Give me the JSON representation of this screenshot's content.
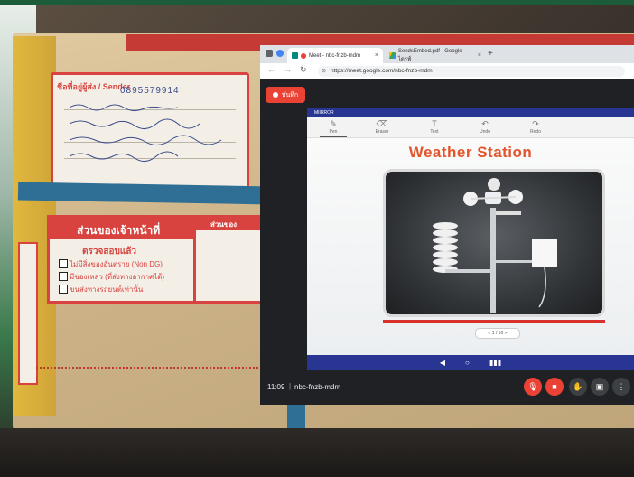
{
  "browser": {
    "tabs": [
      {
        "title": "Meet - nbc-fnzb-mdm",
        "active": true
      },
      {
        "title": "SendsEmbed.pdf - Google ไดรฟ์",
        "active": false
      }
    ],
    "new_tab": "+",
    "url": "https://meet.google.com/nbc-fnzb-mdm"
  },
  "meet": {
    "record_label": "บันทึก",
    "time": "11:09",
    "separator": "|",
    "meeting_code": "nbc-fnzb-mdm"
  },
  "presentation": {
    "topbar_text": "MIIRROR",
    "tools": [
      "Pen",
      "Eraser",
      "Text",
      "Undo",
      "Redo"
    ],
    "slide_title": "Weather Station",
    "pager": "< 1 / 10 >"
  },
  "parcel": {
    "sender_header": "ชื่อที่อยู่ผู้ส่ง / Sender",
    "sender_phone": "0895579914",
    "officer_header": "ส่วนของเจ้าหน้าที่",
    "checked_label": "ตรวจสอบแล้ว",
    "check_items": [
      "ไม่มีสิ่งของอันตราย (Non DG)",
      "มีของเหลว (ที่ส่งทางอากาศได้)",
      "ขนส่งทางรถยนต์เท่านั้น"
    ],
    "officer_header_right": "ส่วนของ"
  },
  "colors": {
    "meet_bg": "#202124",
    "record_red": "#ea4335",
    "slide_title": "#e2552d",
    "android_nav": "#283593",
    "label_red": "#d8433f"
  }
}
